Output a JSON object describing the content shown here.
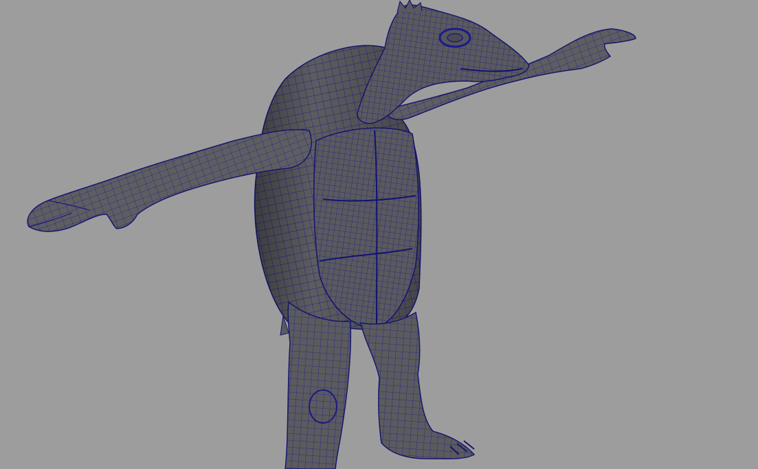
{
  "viewport": {
    "background_color": "#9d9d9d",
    "model": {
      "shading": "wireframe-on-shaded",
      "surface_color": "#5c5c5e",
      "surface_shadow_color": "#3e3e42",
      "wire_color": "#1a1a8c",
      "subject": "turtle-creature-t-pose"
    }
  }
}
